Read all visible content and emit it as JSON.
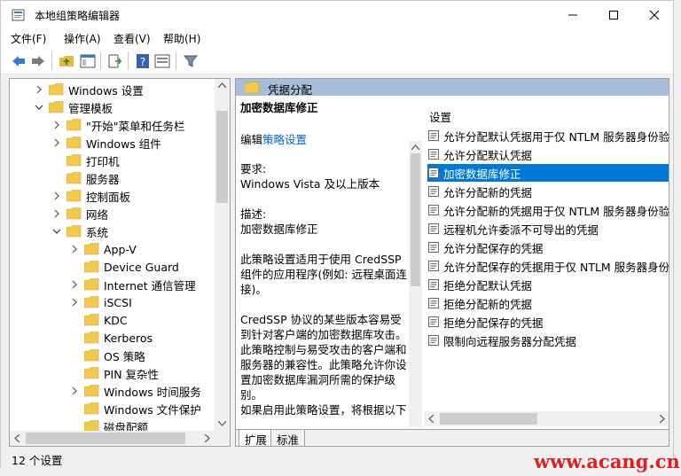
{
  "window": {
    "title": "本地组策略编辑器"
  },
  "menu": {
    "items": [
      "文件(F)",
      "操作(A)",
      "查看(V)",
      "帮助(H)"
    ]
  },
  "tree": {
    "items": [
      {
        "label": "Windows 设置",
        "expander": "right"
      },
      {
        "label": "管理模板",
        "expander": "down"
      },
      {
        "label": "\"开始\"菜单和任务栏",
        "expander": "right"
      },
      {
        "label": "Windows 组件",
        "expander": "right"
      },
      {
        "label": "打印机",
        "expander": "none"
      },
      {
        "label": "服务器",
        "expander": "none"
      },
      {
        "label": "控制面板",
        "expander": "right"
      },
      {
        "label": "网络",
        "expander": "right"
      },
      {
        "label": "系统",
        "expander": "down"
      },
      {
        "label": "App-V",
        "expander": "right"
      },
      {
        "label": "Device Guard",
        "expander": "none"
      },
      {
        "label": "Internet 通信管理",
        "expander": "right"
      },
      {
        "label": "iSCSI",
        "expander": "right"
      },
      {
        "label": "KDC",
        "expander": "none"
      },
      {
        "label": "Kerberos",
        "expander": "none"
      },
      {
        "label": "OS 策略",
        "expander": "none"
      },
      {
        "label": "PIN 复杂性",
        "expander": "none"
      },
      {
        "label": "Windows 时间服务",
        "expander": "right"
      },
      {
        "label": "Windows 文件保护",
        "expander": "none"
      },
      {
        "label": "磁盘配额",
        "expander": "none"
      }
    ]
  },
  "right": {
    "header": "凭据分配",
    "description": {
      "title": "加密数据库修正",
      "edit_prefix": "编辑",
      "edit_link": "策略设置",
      "requirements_label": "要求:",
      "requirements_value": "Windows Vista 及以上版本",
      "desc_label": "描述:",
      "desc_value": "加密数据库修正",
      "para1": "此策略设置适用于使用 CredSSP 组件的应用程序(例如: 远程桌面连接)。",
      "para2": "CredSSP 协议的某些版本容易受到针对客户端的加密数据库攻击。此策略控制与易受攻击的客户端和服务器的兼容性。此策略允许你设置加密数据库漏洞所需的保护级别。",
      "para3": "如果启用此策略设置，将根据以下"
    },
    "list": {
      "column": "设置",
      "selected_index": 2,
      "items": [
        "允许分配默认凭据用于仅 NTLM 服务器身份验证",
        "允许分配默认凭据",
        "加密数据库修正",
        "允许分配新的凭据",
        "允许分配新的凭据用于仅 NTLM 服务器身份验证",
        "远程机允许委派不可导出的凭据",
        "允许分配保存的凭据",
        "允许分配保存的凭据用于仅 NTLM 服务器身份验证",
        "拒绝分配默认凭据",
        "拒绝分配新的凭据",
        "拒绝分配保存的凭据",
        "限制向远程服务器分配凭据"
      ]
    },
    "tabs": [
      "扩展",
      "标准"
    ]
  },
  "status": {
    "text": "12 个设置"
  },
  "watermark": "www.acang.cn",
  "colors": {
    "selection": "#0078d7",
    "header_band": "#a8bed6",
    "folder": "#f2c94c",
    "link": "#0066cc"
  }
}
